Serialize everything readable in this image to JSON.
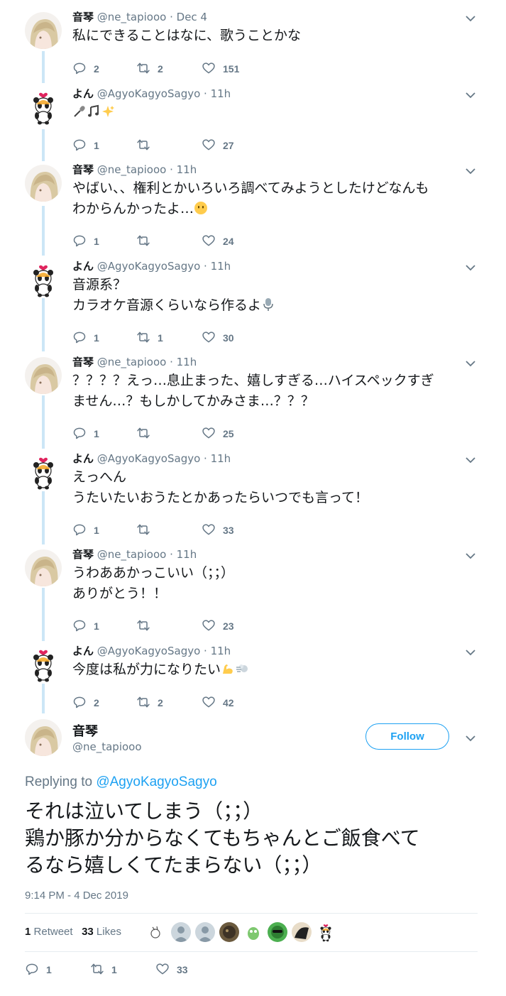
{
  "thread": [
    {
      "name": "音琴",
      "handle": "@ne_tapiooo",
      "time": "Dec 4",
      "text": "私にできることはなに、歌うことかな",
      "replies": "2",
      "retweets": "2",
      "likes": "151",
      "avatar": "girl"
    },
    {
      "name": "よん",
      "handle": "@AgyoKagyoSagyo",
      "time": "11h",
      "text": "",
      "emoji": [
        "microphone",
        "music-notes",
        "sparkles"
      ],
      "replies": "1",
      "retweets": "",
      "likes": "27",
      "avatar": "panda"
    },
    {
      "name": "音琴",
      "handle": "@ne_tapiooo",
      "time": "11h",
      "text": "やばい、、権利とかいろいろ調べてみようとしたけどなんも\nわからんかったよ…",
      "emoji": [
        "neutral-face"
      ],
      "replies": "1",
      "retweets": "",
      "likes": "24",
      "avatar": "girl"
    },
    {
      "name": "よん",
      "handle": "@AgyoKagyoSagyo",
      "time": "11h",
      "text": "音源系？\nカラオケ音源くらいなら作るよ",
      "emoji": [
        "studio-microphone"
      ],
      "replies": "1",
      "retweets": "1",
      "likes": "30",
      "avatar": "panda"
    },
    {
      "name": "音琴",
      "handle": "@ne_tapiooo",
      "time": "11h",
      "text": "？？？？えっ…息止まった、嬉しすぎる…ハイスペックすぎ\nません…？もしかしてかみさま…？？？",
      "replies": "1",
      "retweets": "",
      "likes": "25",
      "avatar": "girl"
    },
    {
      "name": "よん",
      "handle": "@AgyoKagyoSagyo",
      "time": "11h",
      "text": "えっへん\nうたいたいおうたとかあったらいつでも言って！",
      "replies": "1",
      "retweets": "",
      "likes": "33",
      "avatar": "panda"
    },
    {
      "name": "音琴",
      "handle": "@ne_tapiooo",
      "time": "11h",
      "text": "うわああかっこいい（；；）\nありがとう！！",
      "replies": "1",
      "retweets": "",
      "likes": "23",
      "avatar": "girl"
    },
    {
      "name": "よん",
      "handle": "@AgyoKagyoSagyo",
      "time": "11h",
      "text": "今度は私が力になりたい",
      "emoji": [
        "flexed-biceps",
        "dash"
      ],
      "replies": "2",
      "retweets": "2",
      "likes": "42",
      "avatar": "panda"
    }
  ],
  "main_tweet": {
    "name": "音琴",
    "handle": "@ne_tapiooo",
    "follow_label": "Follow",
    "replying_prefix": "Replying to ",
    "replying_to": "@AgyoKagyoSagyo",
    "text": "それは泣いてしまう（；；）\n鶏か豚か分からなくてもちゃんとご飯食べて\nるなら嬉しくてたまらない（；；）",
    "timestamp": "9:14 PM - 4 Dec 2019",
    "retweet_count": "1",
    "retweet_label": "Retweet",
    "like_count": "33",
    "like_label": "Likes",
    "replies": "1",
    "retweets": "1",
    "likes": "33"
  },
  "colors": {
    "accent": "#1da1f2",
    "muted": "#657786",
    "thread_line": "#cce6f6",
    "divider": "#e6ecf0"
  }
}
